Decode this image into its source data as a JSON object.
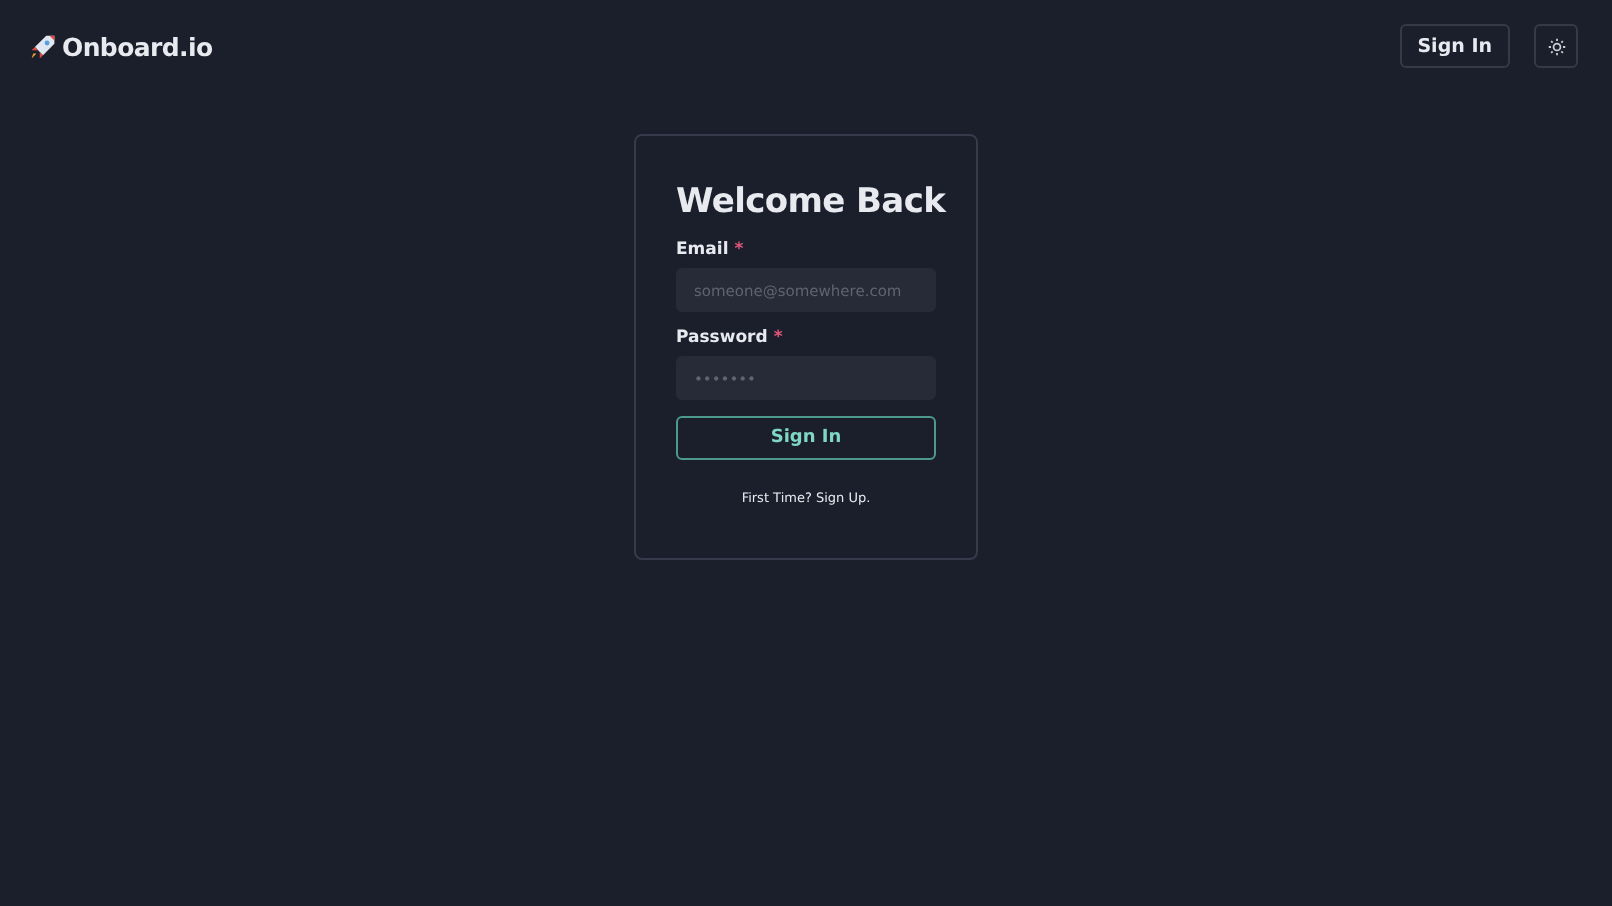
{
  "header": {
    "brand": "Onboard.io",
    "sign_in": "Sign In"
  },
  "card": {
    "title": "Welcome Back",
    "fields": [
      {
        "label": "Email",
        "required_mark": "*",
        "placeholder": "someone@somewhere.com"
      },
      {
        "label": "Password",
        "required_mark": "*",
        "placeholder": "•••••••"
      }
    ],
    "submit": "Sign In",
    "signup_link": "First Time? Sign Up."
  }
}
